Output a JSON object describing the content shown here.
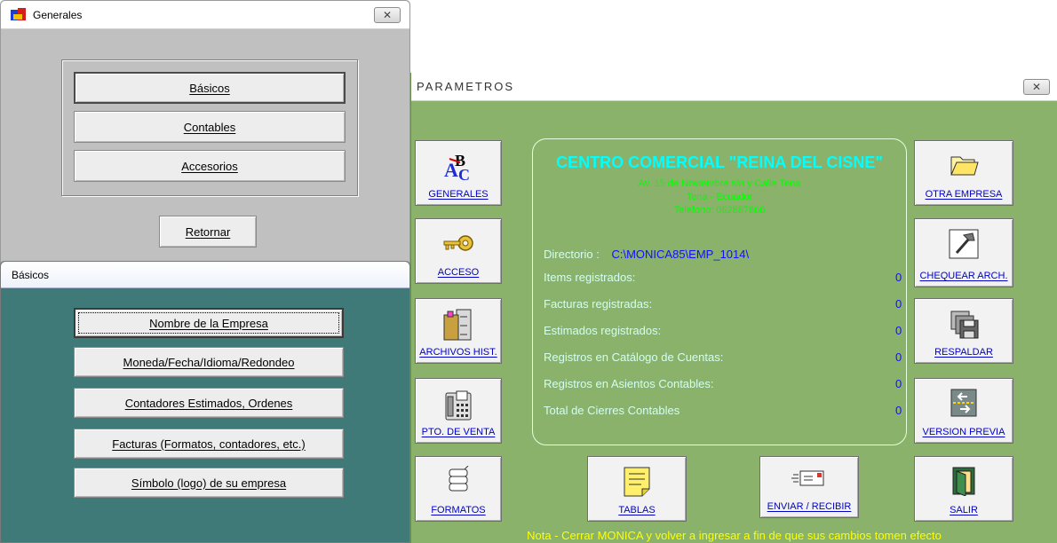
{
  "generales": {
    "title": "Generales",
    "buttons": [
      "Básicos",
      "Contables",
      "Accesorios"
    ],
    "retornar": "Retornar"
  },
  "basicos": {
    "title": "Básicos",
    "buttons": [
      "Nombre de la Empresa",
      "Moneda/Fecha/Idioma/Redondeo",
      "Contadores  Estimados, Ordenes",
      "Facturas (Formatos, contadores, etc.)",
      "Símbolo (logo) de su empresa"
    ]
  },
  "parametros": {
    "title": "PARAMETROS",
    "left_buttons": [
      "GENERALES",
      "ACCESO",
      "ARCHIVOS HIST.",
      "PTO. DE VENTA",
      "FORMATOS"
    ],
    "right_buttons": [
      "OTRA EMPRESA",
      "CHEQUEAR ARCH.",
      "RESPALDAR",
      "VERSION PREVIA",
      "SALIR"
    ],
    "bottom_buttons": [
      "TABLAS",
      "ENVIAR / RECIBIR"
    ],
    "company": {
      "name": "CENTRO COMERCIAL \"REINA DEL CISNE\"",
      "address": "Av. 15 de Noviembre s/n y Calle Tena",
      "city": "Tena - Ecuador",
      "phone": "Telefono: 062887866"
    },
    "directorio_label": "Directorio :",
    "directorio_value": "C:\\MONICA85\\EMP_1014\\",
    "stats": [
      {
        "label": "Items registrados:",
        "value": "0"
      },
      {
        "label": "Facturas registradas:",
        "value": "0"
      },
      {
        "label": "Estimados registrados:",
        "value": "0"
      },
      {
        "label": "Registros en Catálogo de Cuentas:",
        "value": "0"
      },
      {
        "label": "Registros en Asientos Contables:",
        "value": "0"
      },
      {
        "label": "Total de Cierres Contables",
        "value": "0"
      }
    ],
    "note": "Nota - Cerrar MONICA y volver a ingresar a fin de que sus cambios tomen efecto"
  },
  "colors": {
    "parametros_bg": "#8ab26a",
    "basicos_bg": "#3f7a78",
    "company_text": "#00ffff",
    "subtext": "#00ff00",
    "value_blue": "#1010ff",
    "note": "#ffff00"
  }
}
